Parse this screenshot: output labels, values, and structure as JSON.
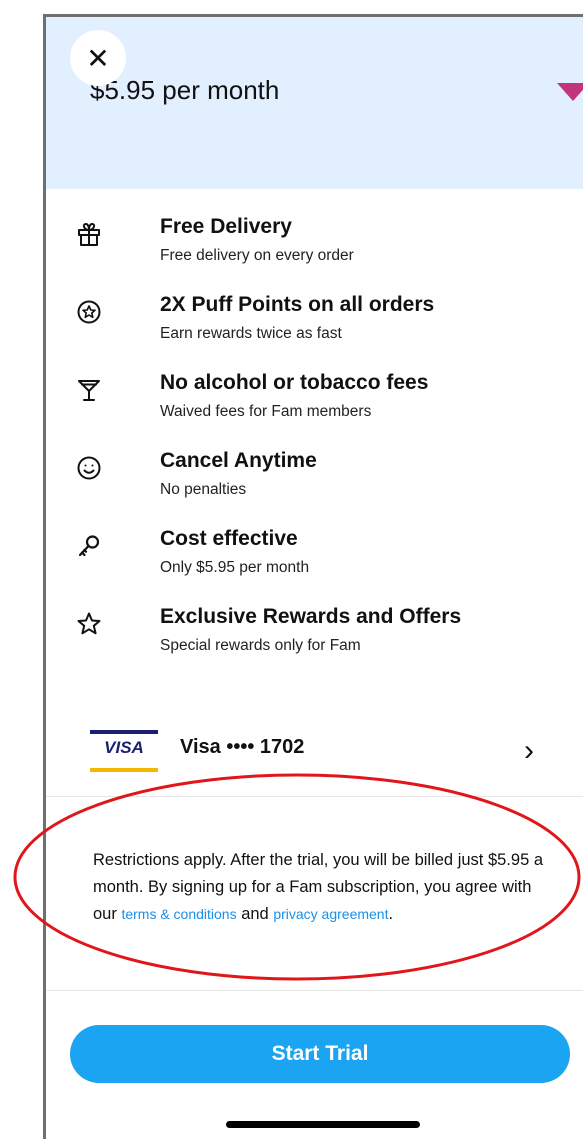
{
  "header": {
    "close_label": "✕",
    "price_text": "$5.95 per month"
  },
  "benefits": [
    {
      "icon": "gift-icon",
      "title": "Free Delivery",
      "subtitle": "Free delivery on every order"
    },
    {
      "icon": "star-badge-icon",
      "title": "2X Puff Points on all orders",
      "subtitle": "Earn rewards twice as fast"
    },
    {
      "icon": "cocktail-icon",
      "title": "No alcohol or tobacco fees",
      "subtitle": "Waived fees for Fam members"
    },
    {
      "icon": "smiley-icon",
      "title": "Cancel Anytime",
      "subtitle": "No penalties"
    },
    {
      "icon": "key-icon",
      "title": "Cost effective",
      "subtitle": "Only $5.95 per month"
    },
    {
      "icon": "star-icon",
      "title": "Exclusive Rewards and Offers",
      "subtitle": "Special rewards only for Fam"
    }
  ],
  "payment": {
    "brand": "VISA",
    "label": "Visa •••• 1702",
    "chevron": "›"
  },
  "legal": {
    "text_before": "Restrictions apply. After the trial, you will be billed just $5.95 a month. By signing up for a Fam subscription, you agree with our ",
    "terms_link": "terms & conditions",
    "text_middle": " and ",
    "privacy_link": "privacy agreement",
    "text_after": "."
  },
  "cta": {
    "label": "Start Trial"
  },
  "colors": {
    "hero_bg": "#e2efff",
    "accent_blue": "#1ba4f2",
    "link_blue": "#1a8fe8",
    "annotation_red": "#e0161b",
    "visa_navy": "#1a1f71",
    "visa_gold": "#f7b600"
  }
}
